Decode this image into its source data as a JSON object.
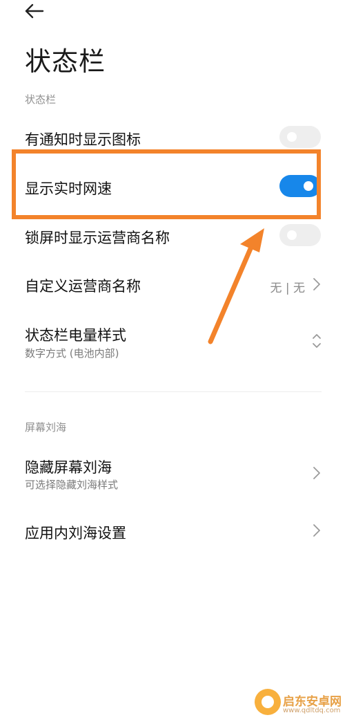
{
  "header": {
    "title": "状态栏"
  },
  "sections": {
    "status_bar": "状态栏",
    "notch": "屏幕刘海"
  },
  "items": {
    "notify_icon": {
      "label": "有通知时显示图标",
      "state": "off"
    },
    "net_speed": {
      "label": "显示实时网速",
      "state": "on"
    },
    "carrier_lock": {
      "label": "锁屏时显示运营商名称",
      "state": "off"
    },
    "custom_carrier": {
      "label": "自定义运营商名称",
      "value": "无 | 无"
    },
    "battery_style": {
      "label": "状态栏电量样式",
      "subtitle": "数字方式 (电池内部)"
    },
    "hide_notch": {
      "label": "隐藏屏幕刘海",
      "subtitle": "可选择隐藏刘海样式"
    },
    "app_notch": {
      "label": "应用内刘海设置"
    }
  },
  "watermark": {
    "name": "启东安卓网",
    "url": "www.qdltdq.com"
  },
  "colors": {
    "toggle_on": "#1787ea",
    "toggle_off": "#eeeeee",
    "highlight": "#f3832b"
  }
}
